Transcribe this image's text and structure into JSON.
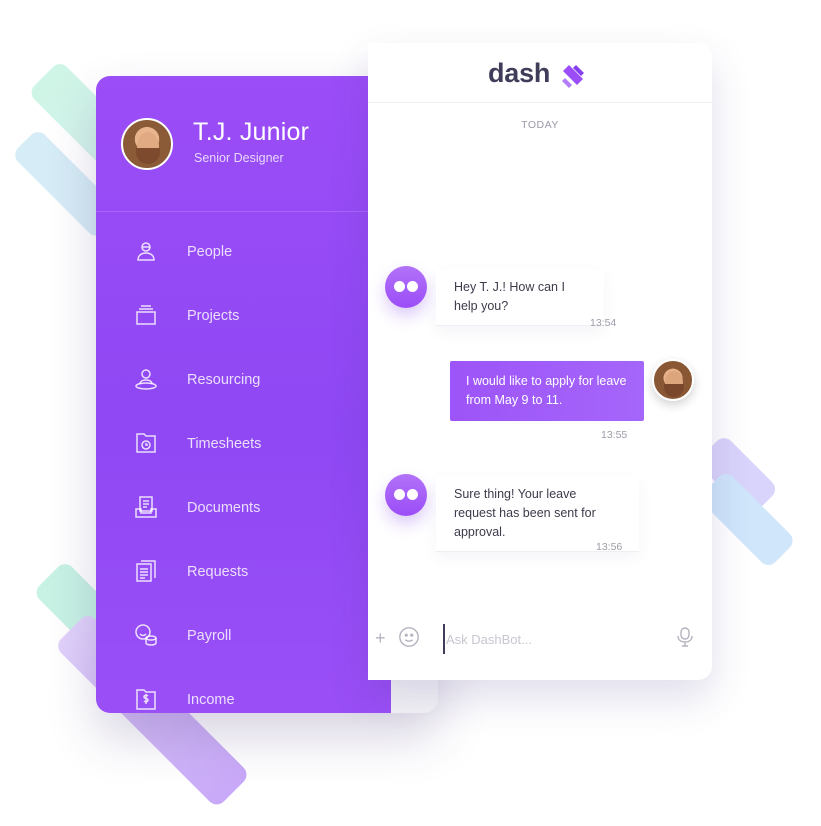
{
  "profile": {
    "name": "T.J. Junior",
    "role": "Senior Designer"
  },
  "sidebar": {
    "items": [
      {
        "label": "People",
        "icon": "people-icon"
      },
      {
        "label": "Projects",
        "icon": "projects-icon"
      },
      {
        "label": "Resourcing",
        "icon": "resourcing-icon"
      },
      {
        "label": "Timesheets",
        "icon": "timesheets-icon"
      },
      {
        "label": "Documents",
        "icon": "documents-icon"
      },
      {
        "label": "Requests",
        "icon": "requests-icon"
      },
      {
        "label": "Payroll",
        "icon": "payroll-icon"
      },
      {
        "label": "Income",
        "icon": "income-icon"
      }
    ]
  },
  "chat": {
    "logo_text": "dash",
    "day_label": "TODAY",
    "messages": [
      {
        "sender": "bot",
        "text": "Hey T. J.! How can I help you?",
        "time": "13:54"
      },
      {
        "sender": "user",
        "text": "I would like to apply for leave from May 9 to 11.",
        "time": "13:55"
      },
      {
        "sender": "bot",
        "text": "Sure thing! Your leave request has been sent for approval.",
        "time": "13:56"
      }
    ],
    "input_placeholder": "Ask DashBot..."
  },
  "colors": {
    "primary": "#9b4df7",
    "sidebar_text": "#ffffff",
    "accent_dark": "#3f3d5a"
  }
}
